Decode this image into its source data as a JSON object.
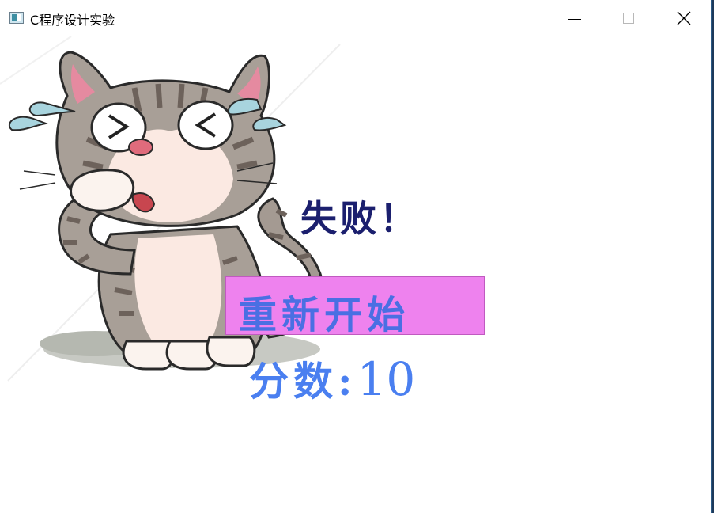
{
  "window": {
    "title": "C程序设计实验",
    "controls": [
      "minimize-icon",
      "maximize-icon",
      "close-icon"
    ]
  },
  "game": {
    "result_text": "失败！",
    "restart_label": "重新开始",
    "score_label": "分数:",
    "score_value": "10"
  },
  "colors": {
    "result_text": "#1b1f6e",
    "restart_bg": "#ee82ee",
    "restart_text": "#4a6fe3",
    "score_text": "#4a7ff0"
  }
}
